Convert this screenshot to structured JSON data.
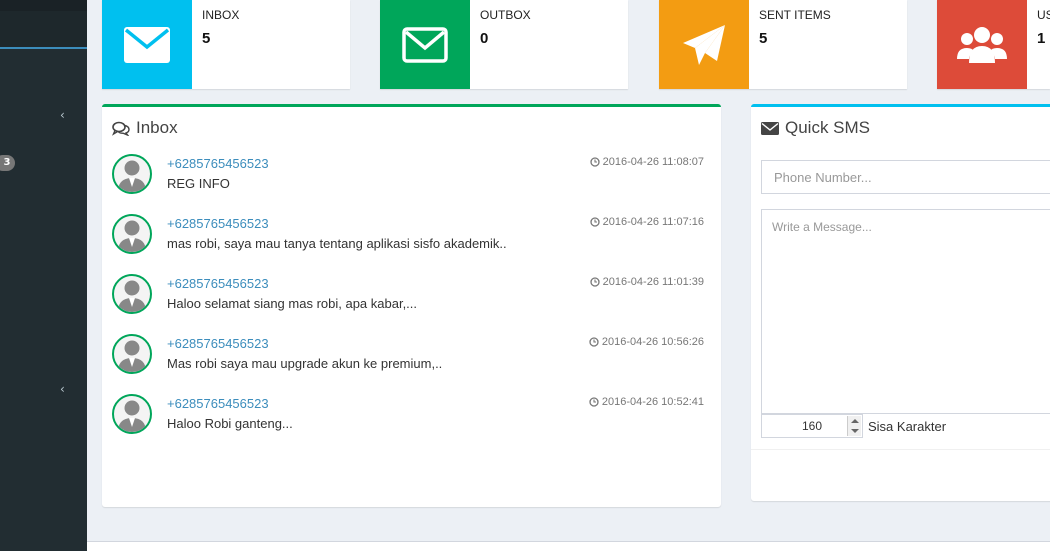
{
  "sidebar": {
    "badge": "3",
    "chevrons": [
      "‹",
      "‹"
    ]
  },
  "info_boxes": [
    {
      "label": "INBOX",
      "count": "5",
      "color": "#00c0ef",
      "icon": "envelope-icon"
    },
    {
      "label": "OUTBOX",
      "count": "0",
      "color": "#00a65a",
      "icon": "envelope-outline-icon"
    },
    {
      "label": "SENT ITEMS",
      "count": "5",
      "color": "#f39c12",
      "icon": "paper-plane-icon"
    },
    {
      "label": "US",
      "count": "1",
      "color": "#dd4b39",
      "icon": "users-icon"
    }
  ],
  "inbox": {
    "title": "Inbox",
    "messages": [
      {
        "phone": "+6285765456523",
        "time": "2016-04-26 11:08:07",
        "text": "REG INFO"
      },
      {
        "phone": "+6285765456523",
        "time": "2016-04-26 11:07:16",
        "text": "mas robi, saya mau tanya tentang aplikasi sisfo akademik.."
      },
      {
        "phone": "+6285765456523",
        "time": "2016-04-26 11:01:39",
        "text": "Haloo selamat siang mas robi, apa kabar,..."
      },
      {
        "phone": "+6285765456523",
        "time": "2016-04-26 10:56:26",
        "text": "Mas robi saya mau upgrade akun ke premium,.."
      },
      {
        "phone": "+6285765456523",
        "time": "2016-04-26 10:52:41",
        "text": "Haloo Robi ganteng..."
      }
    ]
  },
  "quick_sms": {
    "title": "Quick SMS",
    "phone_placeholder": "Phone Number...",
    "message_placeholder": "Write a Message...",
    "counter_value": "160",
    "counter_label": "Sisa Karakter"
  }
}
